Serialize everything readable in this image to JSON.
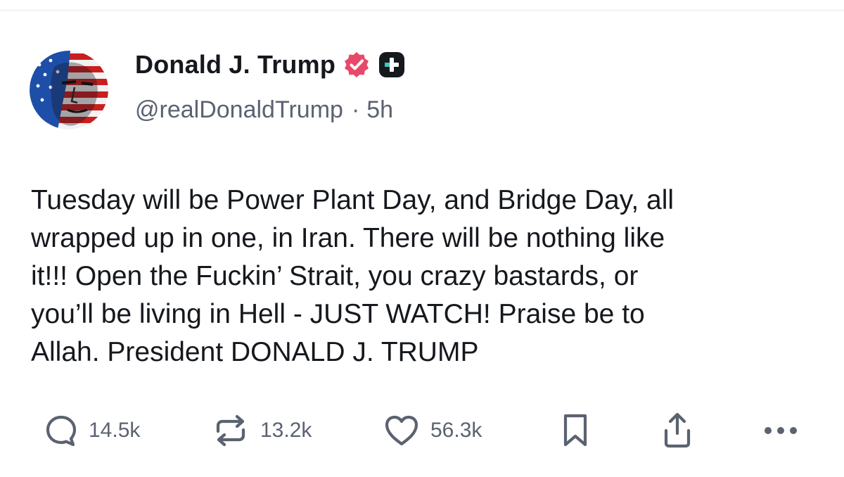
{
  "post": {
    "author": {
      "display_name": "Donald J. Trump",
      "handle": "@realDonaldTrump",
      "verified_icon": "verified-icon",
      "badge_icon": "plus-badge-icon"
    },
    "separator": "·",
    "timestamp": "5h",
    "body": "Tuesday will be Power Plant Day, and Bridge Day, all\nwrapped up in one, in Iran. There will be nothing like\nit!!! Open the Fuckin’ Strait, you crazy bastards, or\nyou’ll be living in Hell - JUST WATCH! Praise be to\nAllah. President DONALD J. TRUMP"
  },
  "actions": {
    "reply": {
      "icon": "reply-icon",
      "count": "14.5k"
    },
    "repost": {
      "icon": "repost-icon",
      "count": "13.2k"
    },
    "like": {
      "icon": "heart-icon",
      "count": "56.3k"
    },
    "bookmark": {
      "icon": "bookmark-icon"
    },
    "share": {
      "icon": "share-icon"
    },
    "more": {
      "icon": "more-icon"
    }
  },
  "colors": {
    "text": "#15181d",
    "muted": "#5b6270",
    "verified": "#e8496b",
    "badge": "#15181d",
    "divider": "#e6e6ea"
  }
}
